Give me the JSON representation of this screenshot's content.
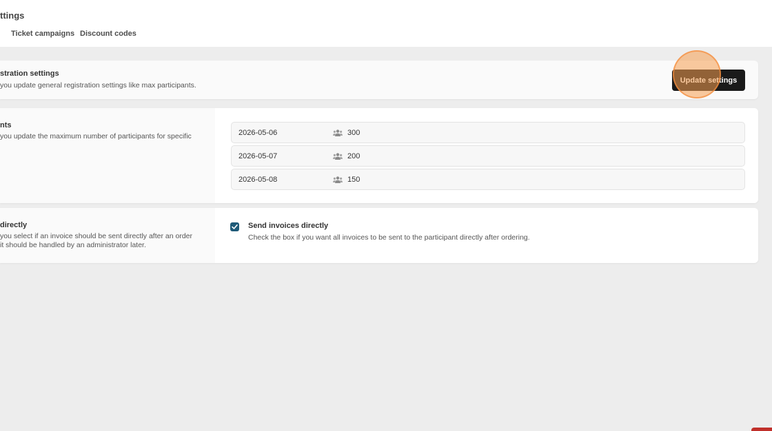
{
  "header": {
    "title": "ttings",
    "tabs": [
      "Ticket campaigns",
      "Discount codes"
    ]
  },
  "registration": {
    "title": "stration settings",
    "description": "you update general registration settings like max participants.",
    "button_label": "Update settings"
  },
  "participants": {
    "title": "nts",
    "description": "you update the maximum number of participants for specific",
    "rows": [
      {
        "date": "2026-05-06",
        "count": "300"
      },
      {
        "date": "2026-05-07",
        "count": "200"
      },
      {
        "date": "2026-05-08",
        "count": "150"
      }
    ]
  },
  "invoices": {
    "title": "directly",
    "description_line1": "you select if an invoice should be sent directly after an order",
    "description_line2": "it should be handled by an administrator later.",
    "checkbox_label": "Send invoices directly",
    "checkbox_description": "Check the box if you want all invoices to be sent to the participant directly after ordering.",
    "checked": true
  },
  "colors": {
    "accent_checkbox": "#1e5a78",
    "button_bg": "#1a1a1a",
    "click_highlight": "#f59e50"
  },
  "icons": {
    "participants": "people-icon",
    "checkbox": "check-icon"
  }
}
